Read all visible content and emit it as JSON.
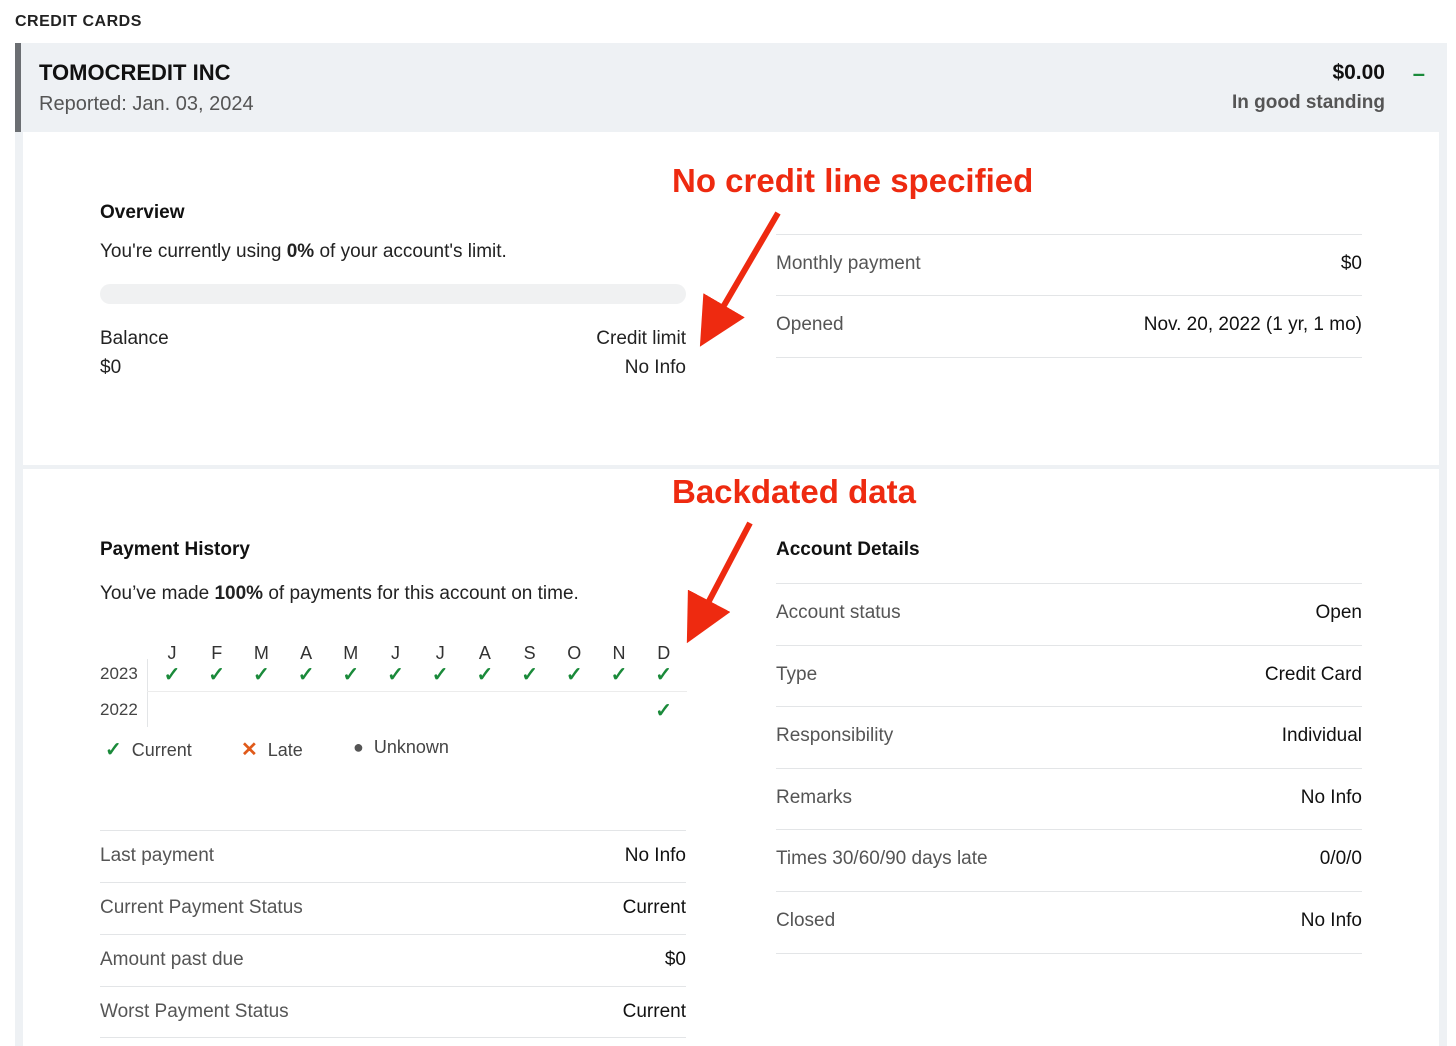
{
  "section_label": "CREDIT CARDS",
  "account": {
    "name": "TOMOCREDIT INC",
    "reported": "Reported: Jan. 03, 2024",
    "amount": "$0.00",
    "standing": "In good standing",
    "toggle": "–"
  },
  "overview": {
    "title": "Overview",
    "usage_prefix": "You're currently using ",
    "usage_pct": "0%",
    "usage_suffix": " of your account's limit.",
    "usage_fraction": 0,
    "balance_label": "Balance",
    "balance_value": "$0",
    "limit_label": "Credit limit",
    "limit_value": "No Info"
  },
  "overview_details": [
    {
      "label": "Monthly payment",
      "value": "$0"
    },
    {
      "label": "Opened",
      "value": "Nov. 20, 2022 (1 yr, 1 mo)"
    }
  ],
  "payment_history": {
    "title": "Payment History",
    "summary_prefix": "You’ve made ",
    "summary_pct": "100%",
    "summary_suffix": " of payments for this account on time.",
    "months": [
      "J",
      "F",
      "M",
      "A",
      "M",
      "J",
      "J",
      "A",
      "S",
      "O",
      "N",
      "D"
    ],
    "years": [
      {
        "year": "2023",
        "statuses": [
          "current",
          "current",
          "current",
          "current",
          "current",
          "current",
          "current",
          "current",
          "current",
          "current",
          "current",
          "current"
        ]
      },
      {
        "year": "2022",
        "statuses": [
          "",
          "",
          "",
          "",
          "",
          "",
          "",
          "",
          "",
          "",
          "",
          "current"
        ]
      }
    ],
    "legend": {
      "current": "Current",
      "late": "Late",
      "unknown": "Unknown"
    },
    "rows": [
      {
        "label": "Last payment",
        "value": "No Info"
      },
      {
        "label": "Current Payment Status",
        "value": "Current"
      },
      {
        "label": "Amount past due",
        "value": "$0"
      },
      {
        "label": "Worst Payment Status",
        "value": "Current"
      }
    ]
  },
  "account_details": {
    "title": "Account Details",
    "rows": [
      {
        "label": "Account status",
        "value": "Open"
      },
      {
        "label": "Type",
        "value": "Credit Card"
      },
      {
        "label": "Responsibility",
        "value": "Individual"
      },
      {
        "label": "Remarks",
        "value": "No Info"
      },
      {
        "label": "Times 30/60/90 days late",
        "value": "0/0/0"
      },
      {
        "label": "Closed",
        "value": "No Info"
      }
    ]
  },
  "annotations": {
    "top": "No credit line specified",
    "bottom": "Backdated data"
  },
  "colors": {
    "check": "#1a8a3a",
    "late": "#e05a1a",
    "unknown": "#555555",
    "annotation": "#ee2a10"
  }
}
